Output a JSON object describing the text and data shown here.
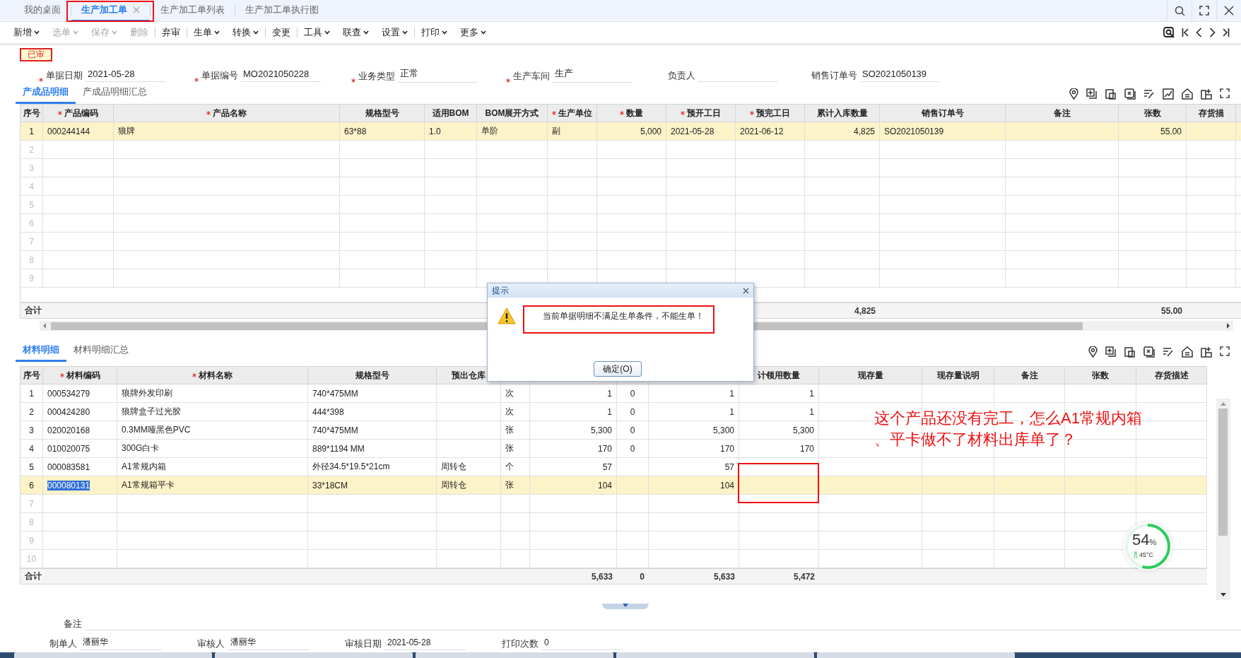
{
  "tabs": [
    {
      "label": "我的桌面",
      "selected": false,
      "closable": false
    },
    {
      "label": "生产加工单",
      "selected": true,
      "closable": true
    },
    {
      "label": "生产加工单列表",
      "selected": false,
      "closable": false
    },
    {
      "label": "生产加工单执行图",
      "selected": false,
      "closable": false
    }
  ],
  "toolbar": [
    {
      "label": "新增",
      "disabled": false,
      "dropdown": true,
      "separator_after": false
    },
    {
      "label": "选单",
      "disabled": true,
      "dropdown": true,
      "separator_after": false
    },
    {
      "label": "保存",
      "disabled": true,
      "dropdown": true,
      "separator_after": false
    },
    {
      "label": "删除",
      "disabled": true,
      "dropdown": false,
      "separator_after": true
    },
    {
      "label": "弃审",
      "disabled": false,
      "dropdown": false,
      "separator_after": true
    },
    {
      "label": "生单",
      "disabled": false,
      "dropdown": true,
      "separator_after": false
    },
    {
      "label": "转换",
      "disabled": false,
      "dropdown": true,
      "separator_after": true
    },
    {
      "label": "变更",
      "disabled": false,
      "dropdown": false,
      "separator_after": true
    },
    {
      "label": "工具",
      "disabled": false,
      "dropdown": true,
      "separator_after": false
    },
    {
      "label": "联查",
      "disabled": false,
      "dropdown": true,
      "separator_after": false
    },
    {
      "label": "设置",
      "disabled": false,
      "dropdown": true,
      "separator_after": true
    },
    {
      "label": "打印",
      "disabled": false,
      "dropdown": true,
      "separator_after": false
    },
    {
      "label": "更多",
      "disabled": false,
      "dropdown": true,
      "separator_after": false
    }
  ],
  "status_badge": "已审",
  "header_fields": [
    {
      "label": "单据日期",
      "required": true,
      "value": "2021-05-28"
    },
    {
      "label": "单据编号",
      "required": true,
      "value": "MO2021050228"
    },
    {
      "label": "业务类型",
      "required": true,
      "value": "正常"
    },
    {
      "label": "生产车间",
      "required": true,
      "value": "生产"
    },
    {
      "label": "负责人",
      "required": false
    },
    {
      "label": "销售订单号",
      "required": false,
      "value": "SO2021050139"
    }
  ],
  "product_section": {
    "subtabs": [
      {
        "label": "产成品明细",
        "selected": true
      },
      {
        "label": "产成品明细汇总",
        "selected": false
      }
    ],
    "table": {
      "columns": {
        "no": {
          "label": "序号",
          "required": false
        },
        "code": {
          "label": "产品编码",
          "required": true
        },
        "name": {
          "label": "产品名称",
          "required": true
        },
        "spec": {
          "label": "规格型号",
          "required": false
        },
        "bom": {
          "label": "适用BOM",
          "required": false
        },
        "mode": {
          "label": "BOM展开方式",
          "required": false
        },
        "unit": {
          "label": "生产单位",
          "required": true
        },
        "qty": {
          "label": "数量",
          "required": true
        },
        "start": {
          "label": "预开工日",
          "required": true
        },
        "finish": {
          "label": "预完工日",
          "required": true
        },
        "stocked": {
          "label": "累计入库数量",
          "required": false
        },
        "order": {
          "label": "销售订单号",
          "required": false
        },
        "note": {
          "label": "备注",
          "required": false
        },
        "sheets": {
          "label": "张数",
          "required": false
        },
        "desc": {
          "label": "存货描",
          "required": false
        }
      },
      "rows": [
        {
          "no": "1",
          "code": "000244144",
          "name": "狼牌",
          "spec": "63*88",
          "bom": "1.0",
          "mode": "单阶",
          "unit": "副",
          "qty": "5,000",
          "start": "2021-05-28",
          "finish": "2021-06-12",
          "stocked": "4,825",
          "order": "SO2021050139",
          "sheets": "55.00",
          "selected": true
        },
        {
          "no": "2",
          "selected": false
        },
        {
          "no": "3",
          "selected": false
        },
        {
          "no": "4",
          "selected": false
        },
        {
          "no": "5",
          "selected": false
        },
        {
          "no": "6",
          "selected": false
        },
        {
          "no": "7",
          "selected": false
        },
        {
          "no": "8",
          "selected": false
        },
        {
          "no": "9",
          "selected": false
        }
      ],
      "totals": {
        "no": "合计",
        "stocked": "4,825",
        "sheets": "55.00"
      }
    }
  },
  "material_section": {
    "subtabs": [
      {
        "label": "材料明细",
        "selected": true
      },
      {
        "label": "材料明细汇总",
        "selected": false
      }
    ],
    "table": {
      "columns": {
        "no": {
          "label": "序号",
          "required": false
        },
        "code": {
          "label": "材料编码",
          "required": true
        },
        "name": {
          "label": "材料名称",
          "required": true
        },
        "spec": {
          "label": "规格型号",
          "required": false
        },
        "warehouse": {
          "label": "预出仓库",
          "required": false
        },
        "issued": {
          "label": "计领用数量",
          "required": false
        },
        "stock": {
          "label": "现存量",
          "required": false
        },
        "stock_note": {
          "label": "现存量说明",
          "required": false
        },
        "note": {
          "label": "备注",
          "required": false
        },
        "sheets": {
          "label": "张数",
          "required": false
        },
        "desc": {
          "label": "存货描述",
          "required": false
        }
      },
      "rows": [
        {
          "no": "1",
          "code": "000534279",
          "name": "狼牌外发印刷",
          "spec": "740*475MM",
          "column_6": "次",
          "column_7": "1",
          "column_8": "0",
          "column_9": "1",
          "issued": "1",
          "selected": false
        },
        {
          "no": "2",
          "code": "000424280",
          "name": "狼牌盒子过光胶",
          "spec": "444*398",
          "column_6": "次",
          "column_7": "1",
          "column_8": "0",
          "column_9": "1",
          "issued": "1",
          "selected": false
        },
        {
          "no": "3",
          "code": "020020168",
          "name": "0.3MM哑黑色PVC",
          "spec": "740*475MM",
          "column_6": "张",
          "column_7": "5,300",
          "column_8": "0",
          "column_9": "5,300",
          "issued": "5,300",
          "selected": false
        },
        {
          "no": "4",
          "code": "010020075",
          "name": "300G白卡",
          "spec": "889*1194 MM",
          "column_6": "张",
          "column_7": "170",
          "column_8": "0",
          "column_9": "170",
          "issued": "170",
          "selected": false
        },
        {
          "no": "5",
          "code": "000083581",
          "name": "A1常规内箱",
          "spec": "外径34.5*19.5*21cm",
          "warehouse": "周转仓",
          "column_6": "个",
          "column_7": "57",
          "column_9": "57",
          "selected": false
        },
        {
          "no": "6",
          "code": "000080131",
          "name": "A1常规箱平卡",
          "spec": "33*18CM",
          "warehouse": "周转仓",
          "column_6": "张",
          "column_7": "104",
          "column_9": "104",
          "selected": true
        },
        {
          "no": "7",
          "selected": false
        },
        {
          "no": "8",
          "selected": false
        },
        {
          "no": "9",
          "selected": false
        },
        {
          "no": "10",
          "selected": false
        }
      ],
      "totals": {
        "no": "合计",
        "column_7": "5,633",
        "column_8": "0",
        "column_9": "5,633",
        "issued": "5,472"
      }
    }
  },
  "footer": {
    "note_label": "备注",
    "fields": [
      {
        "label": "制单人",
        "value": "潘丽华"
      },
      {
        "label": "审核人",
        "value": "潘丽华"
      },
      {
        "label": "审核日期",
        "value": "2021-05-28"
      },
      {
        "label": "打印次数",
        "value": "0"
      }
    ]
  },
  "dialog": {
    "title": "提示",
    "message": "当前单据明细不满足生单条件，不能生单！",
    "button": "确定(O)"
  },
  "annotation_lines": [
    "这个产品还没有完工，怎么A1常规内箱",
    "、平卡做不了材料出库单了？"
  ],
  "gauge": {
    "value": "54",
    "unit": "%",
    "temperature": "45°C",
    "level": 0.54
  }
}
